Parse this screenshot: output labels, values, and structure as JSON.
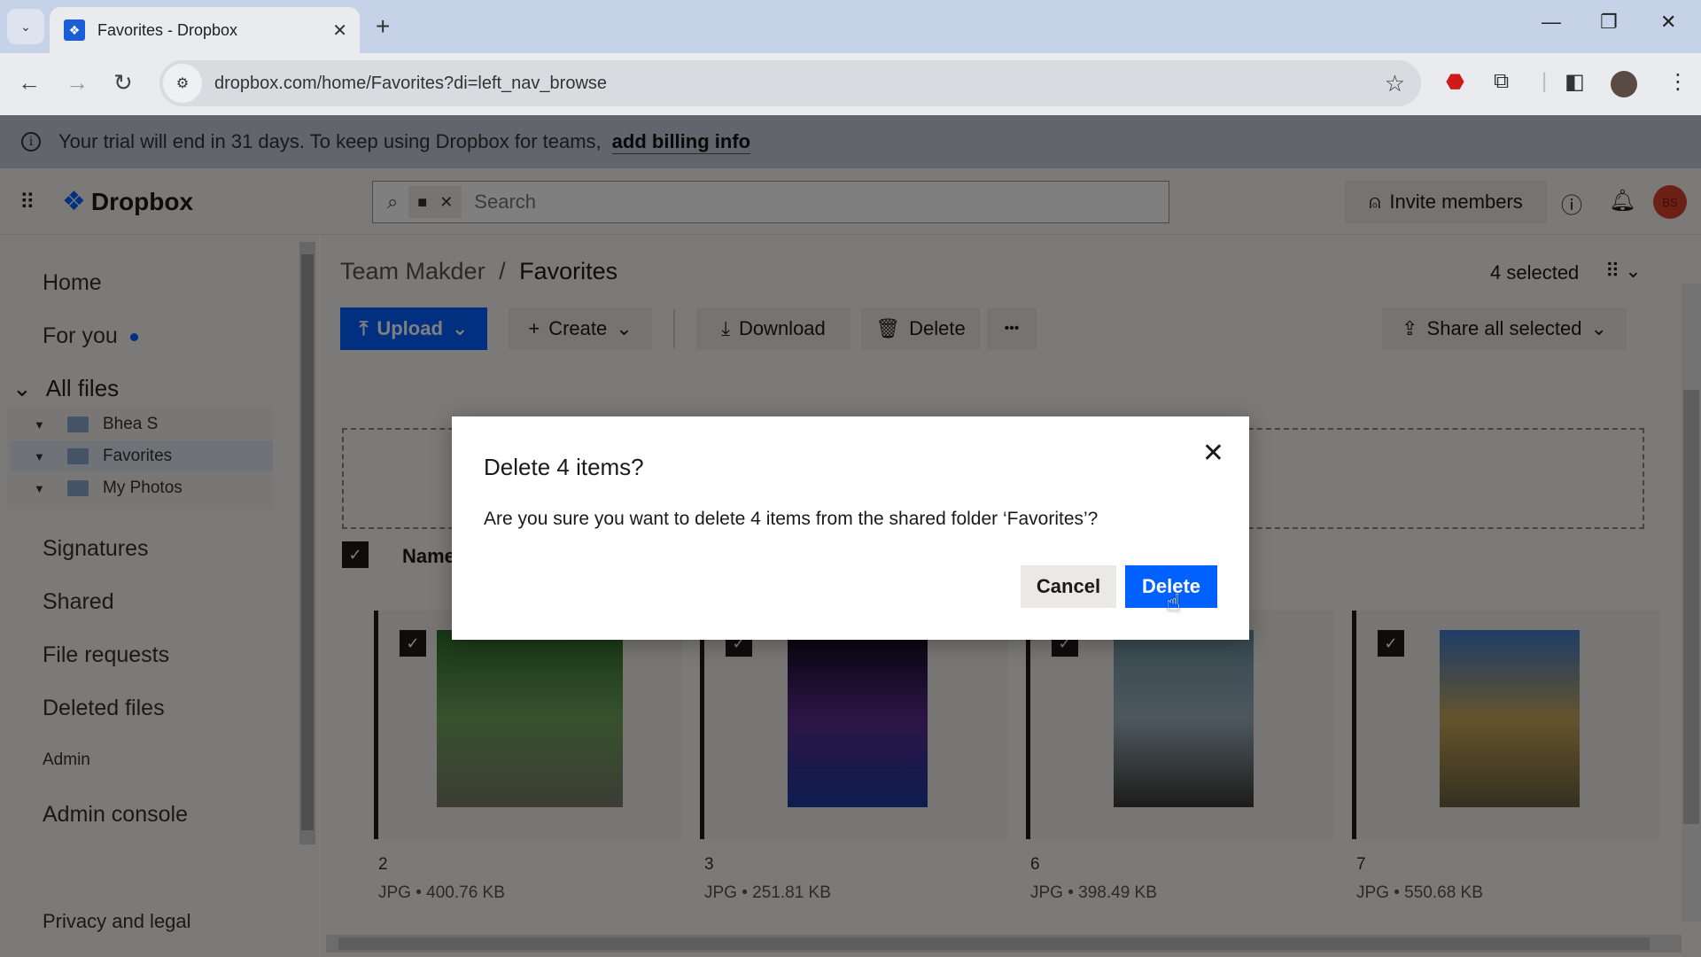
{
  "browser": {
    "tab_title": "Favorites - Dropbox",
    "url": "dropbox.com/home/Favorites?di=left_nav_browse"
  },
  "banner": {
    "text": "Your trial will end in 31 days. To keep using Dropbox for teams,",
    "link": "add billing info"
  },
  "header": {
    "logo": "Dropbox",
    "search_placeholder": "Search",
    "invite_label": "Invite members",
    "avatar_initials": "BS"
  },
  "sidebar": {
    "items": [
      {
        "label": "Home"
      },
      {
        "label": "For you"
      },
      {
        "label": "All files"
      },
      {
        "label": "Signatures"
      },
      {
        "label": "Shared"
      },
      {
        "label": "File requests"
      },
      {
        "label": "Deleted files"
      },
      {
        "label": "Admin"
      },
      {
        "label": "Admin console"
      },
      {
        "label": "Privacy and legal"
      }
    ],
    "tree": [
      {
        "label": "Bhea S"
      },
      {
        "label": "Favorites",
        "selected": true
      },
      {
        "label": "My Photos"
      }
    ]
  },
  "content": {
    "breadcrumb_parent": "Team Makder",
    "breadcrumb_sep": "/",
    "breadcrumb_current": "Favorites",
    "selected_count": "4 selected",
    "buttons": {
      "upload": "Upload",
      "create": "Create",
      "download": "Download",
      "delete": "Delete",
      "more": "•••",
      "share_all": "Share all selected"
    },
    "column_name": "Name",
    "files": [
      {
        "name": "2",
        "meta": "JPG • 400.76 KB",
        "colors": [
          "#2f6d2a",
          "#6fa35a",
          "#7a7a6a"
        ]
      },
      {
        "name": "3",
        "meta": "JPG • 251.81 KB",
        "colors": [
          "#0a0a1a",
          "#5a2a8a",
          "#1a3aa0"
        ]
      },
      {
        "name": "6",
        "meta": "JPG • 398.49 KB",
        "colors": [
          "#6d8ea0",
          "#9ab0bc",
          "#3a3a36"
        ]
      },
      {
        "name": "7",
        "meta": "JPG • 550.68 KB",
        "colors": [
          "#3c7ad0",
          "#c9a85a",
          "#6a6040"
        ]
      }
    ]
  },
  "dialog": {
    "title": "Delete 4 items?",
    "message": "Are you sure you want to delete 4 items from the shared folder ‘Favorites’?",
    "cancel_label": "Cancel",
    "confirm_label": "Delete"
  },
  "colors": {
    "accent": "#0061fe",
    "avatar": "#d8432f"
  }
}
